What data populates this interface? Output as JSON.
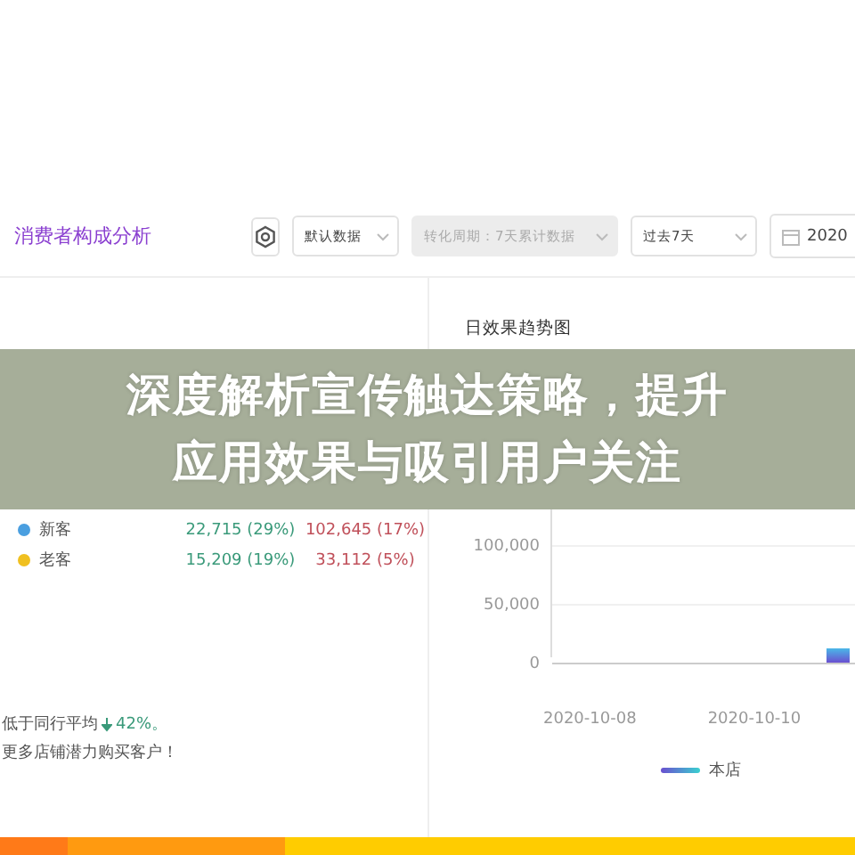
{
  "header": {
    "title": "消费者构成分析",
    "dropdowns": [
      {
        "label": "默认数据",
        "disabled": false
      },
      {
        "label": "转化周期：7天累计数据",
        "disabled": true
      },
      {
        "label": "过去7天",
        "disabled": false
      }
    ],
    "date": "2020"
  },
  "table": {
    "rows": [
      {
        "name": "新客",
        "color": "#4a9fe0",
        "own": "22,715 (29%)",
        "peer": "102,645 (17%)"
      },
      {
        "name": "老客",
        "color": "#f0c020",
        "own": "15,209 (19%)",
        "peer": "33,112 (5%)"
      }
    ]
  },
  "note": {
    "line_1": "低于同行平均",
    "change": "42%。",
    "line_2": "更多店铺潜力购买客户！"
  },
  "trend": {
    "title": "日效果趋势图",
    "y_ticks": [
      "100,000",
      "50,000",
      "0"
    ],
    "x_labels": [
      "2020-10-08",
      "2020-10-10"
    ],
    "legend": "本店"
  },
  "banner": {
    "lines": [
      "深度解析宣传触达策略，提升",
      "应用效果与吸引用户关注"
    ]
  }
}
